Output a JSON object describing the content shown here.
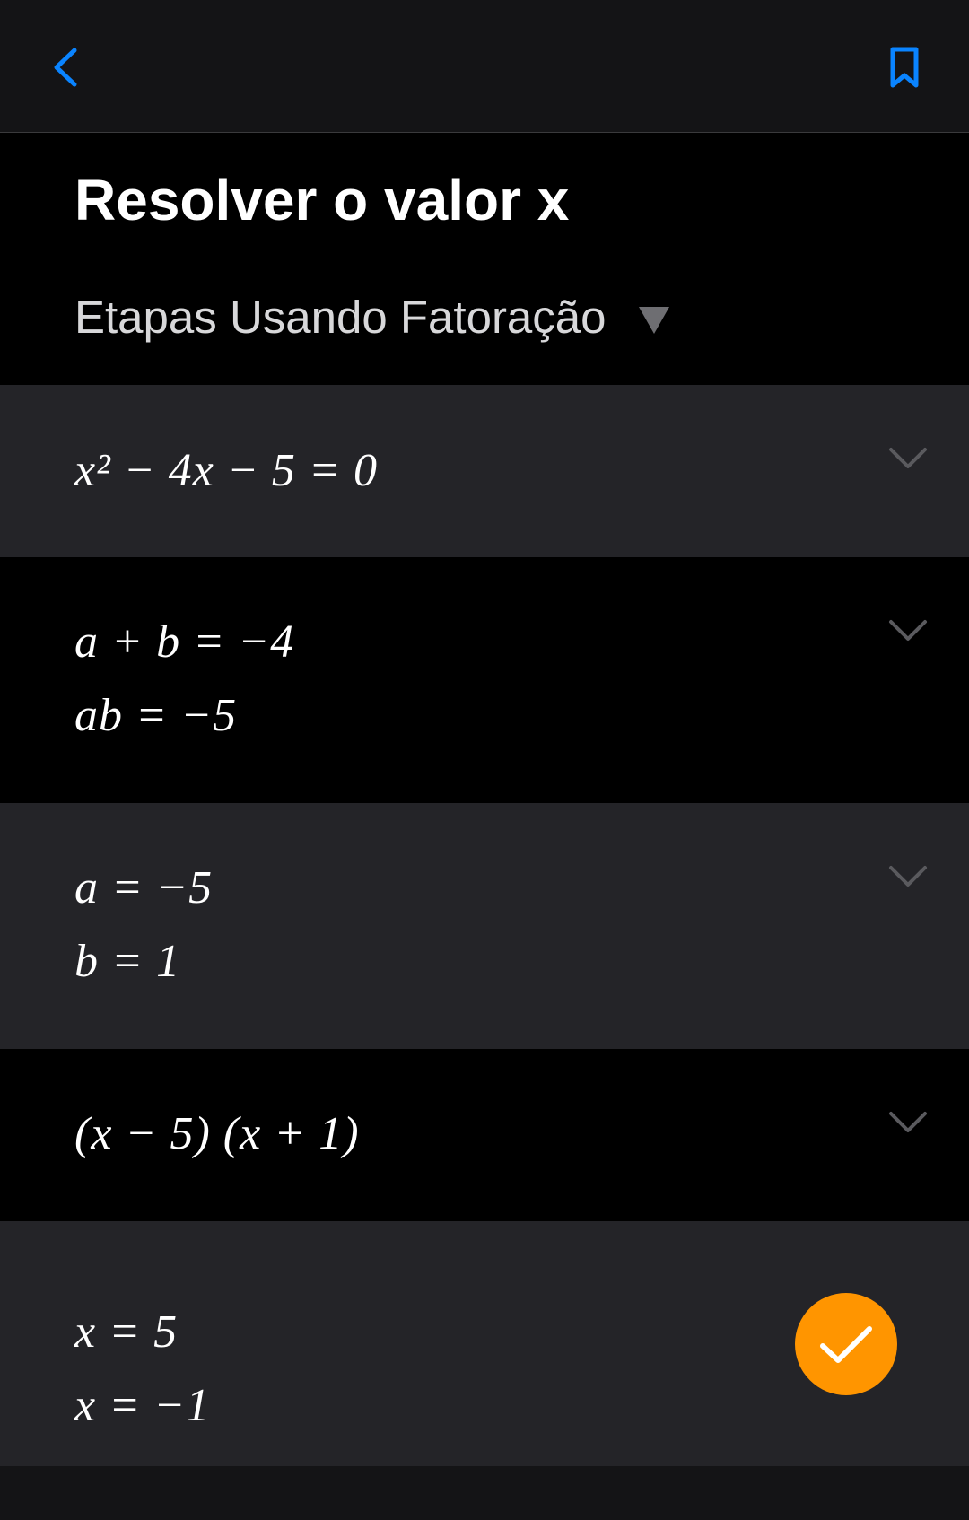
{
  "colors": {
    "accent": "#0a84ff",
    "success": "#ff9500",
    "background": "#000000",
    "row_alt": "#242428"
  },
  "topbar": {
    "back_icon": "chevron-left-icon",
    "bookmark_icon": "bookmark-icon"
  },
  "header": {
    "title": "Resolver o valor x",
    "method_label": "Etapas Usando Fatoração",
    "method_caret_icon": "caret-down-icon"
  },
  "steps": [
    {
      "lines": [
        "x² − 4x − 5 = 0"
      ],
      "expand_icon": "chevron-down-icon"
    },
    {
      "lines": [
        "a + b = −4",
        "ab = −5"
      ],
      "expand_icon": "chevron-down-icon"
    },
    {
      "lines": [
        "a = −5",
        "b = 1"
      ],
      "expand_icon": "chevron-down-icon"
    },
    {
      "lines": [
        "(x − 5) (x + 1)"
      ],
      "expand_icon": "chevron-down-icon"
    },
    {
      "lines": [
        "x = 5",
        "x = −1"
      ],
      "status_icon": "checkmark-icon"
    }
  ]
}
